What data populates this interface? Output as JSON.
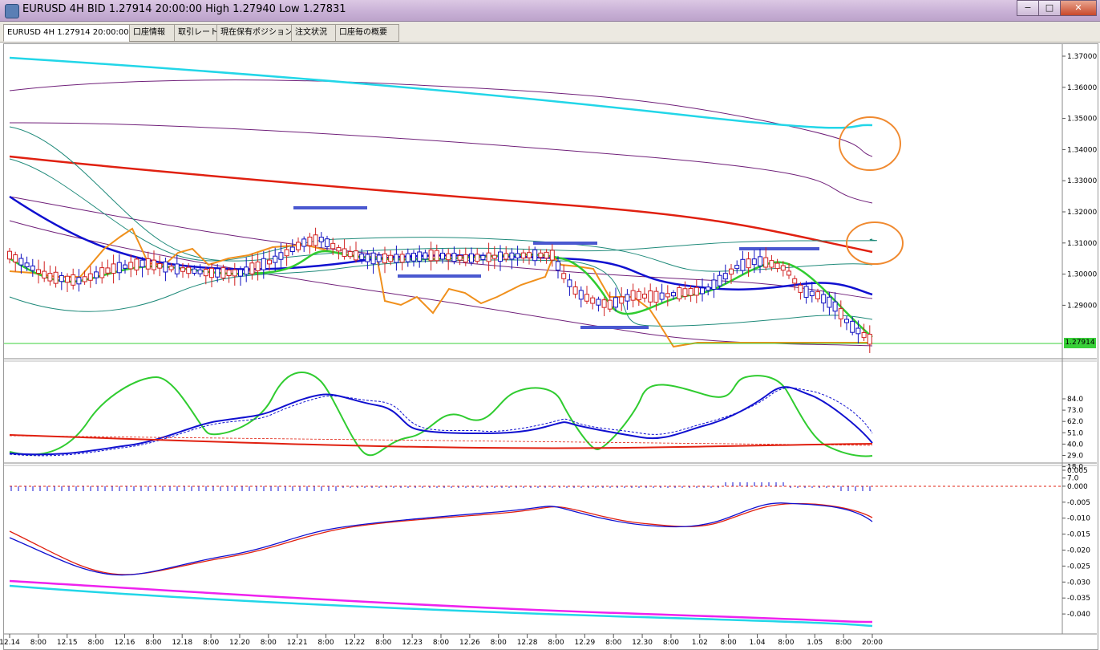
{
  "window": {
    "title": "EURUSD 4H BID 1.27914 20:00:00 High 1.27940 Low 1.27831",
    "minimize": "−",
    "maximize": "□",
    "close": "✕"
  },
  "tabs": [
    {
      "label": "EURUSD 4H 1.27914 20:00:00"
    },
    {
      "label": "口座情報"
    },
    {
      "label": "取引レート"
    },
    {
      "label": "現在保有ポジション"
    },
    {
      "label": "注文状況"
    },
    {
      "label": "口座毎の概要"
    }
  ],
  "price_axis": {
    "labels": [
      "1.37000",
      "1.36000",
      "1.35000",
      "1.34000",
      "1.33000",
      "1.32000",
      "1.31000",
      "1.30000",
      "1.29000"
    ],
    "current": "1.27914"
  },
  "stoch_axis": {
    "labels": [
      "84.0",
      "73.0",
      "62.0",
      "51.0",
      "40.0",
      "29.0",
      "18.0",
      "7.0"
    ]
  },
  "macd_axis": {
    "labels": [
      "0.005",
      "0.000",
      "-0.005",
      "-0.010",
      "-0.015",
      "-0.020",
      "-0.025",
      "-0.030",
      "-0.035",
      "-0.040"
    ]
  },
  "time_axis": {
    "labels": [
      "12.14",
      "8:00",
      "12.15",
      "8:00",
      "12.16",
      "8:00",
      "12.18",
      "8:00",
      "12.20",
      "8:00",
      "12.21",
      "8:00",
      "12.22",
      "8:00",
      "12.23",
      "8:00",
      "12.26",
      "8:00",
      "12.28",
      "8:00",
      "12.29",
      "8:00",
      "12.30",
      "8:00",
      "1.02",
      "8:00",
      "1.04",
      "8:00",
      "1.05",
      "8:00",
      "20:00"
    ]
  },
  "colors": {
    "cyan_ma": "#22d6e8",
    "red_ma": "#e02010",
    "blue_ma": "#1010d0",
    "green_ma": "#30cc30",
    "orange_line": "#f0901c",
    "bollinger": "#1f8a7a",
    "purple_band": "#70207a",
    "annotation": "#4a58d0",
    "circle": "#f08a30",
    "bull_candle": "#1010c0",
    "bear_candle": "#d02020"
  }
}
